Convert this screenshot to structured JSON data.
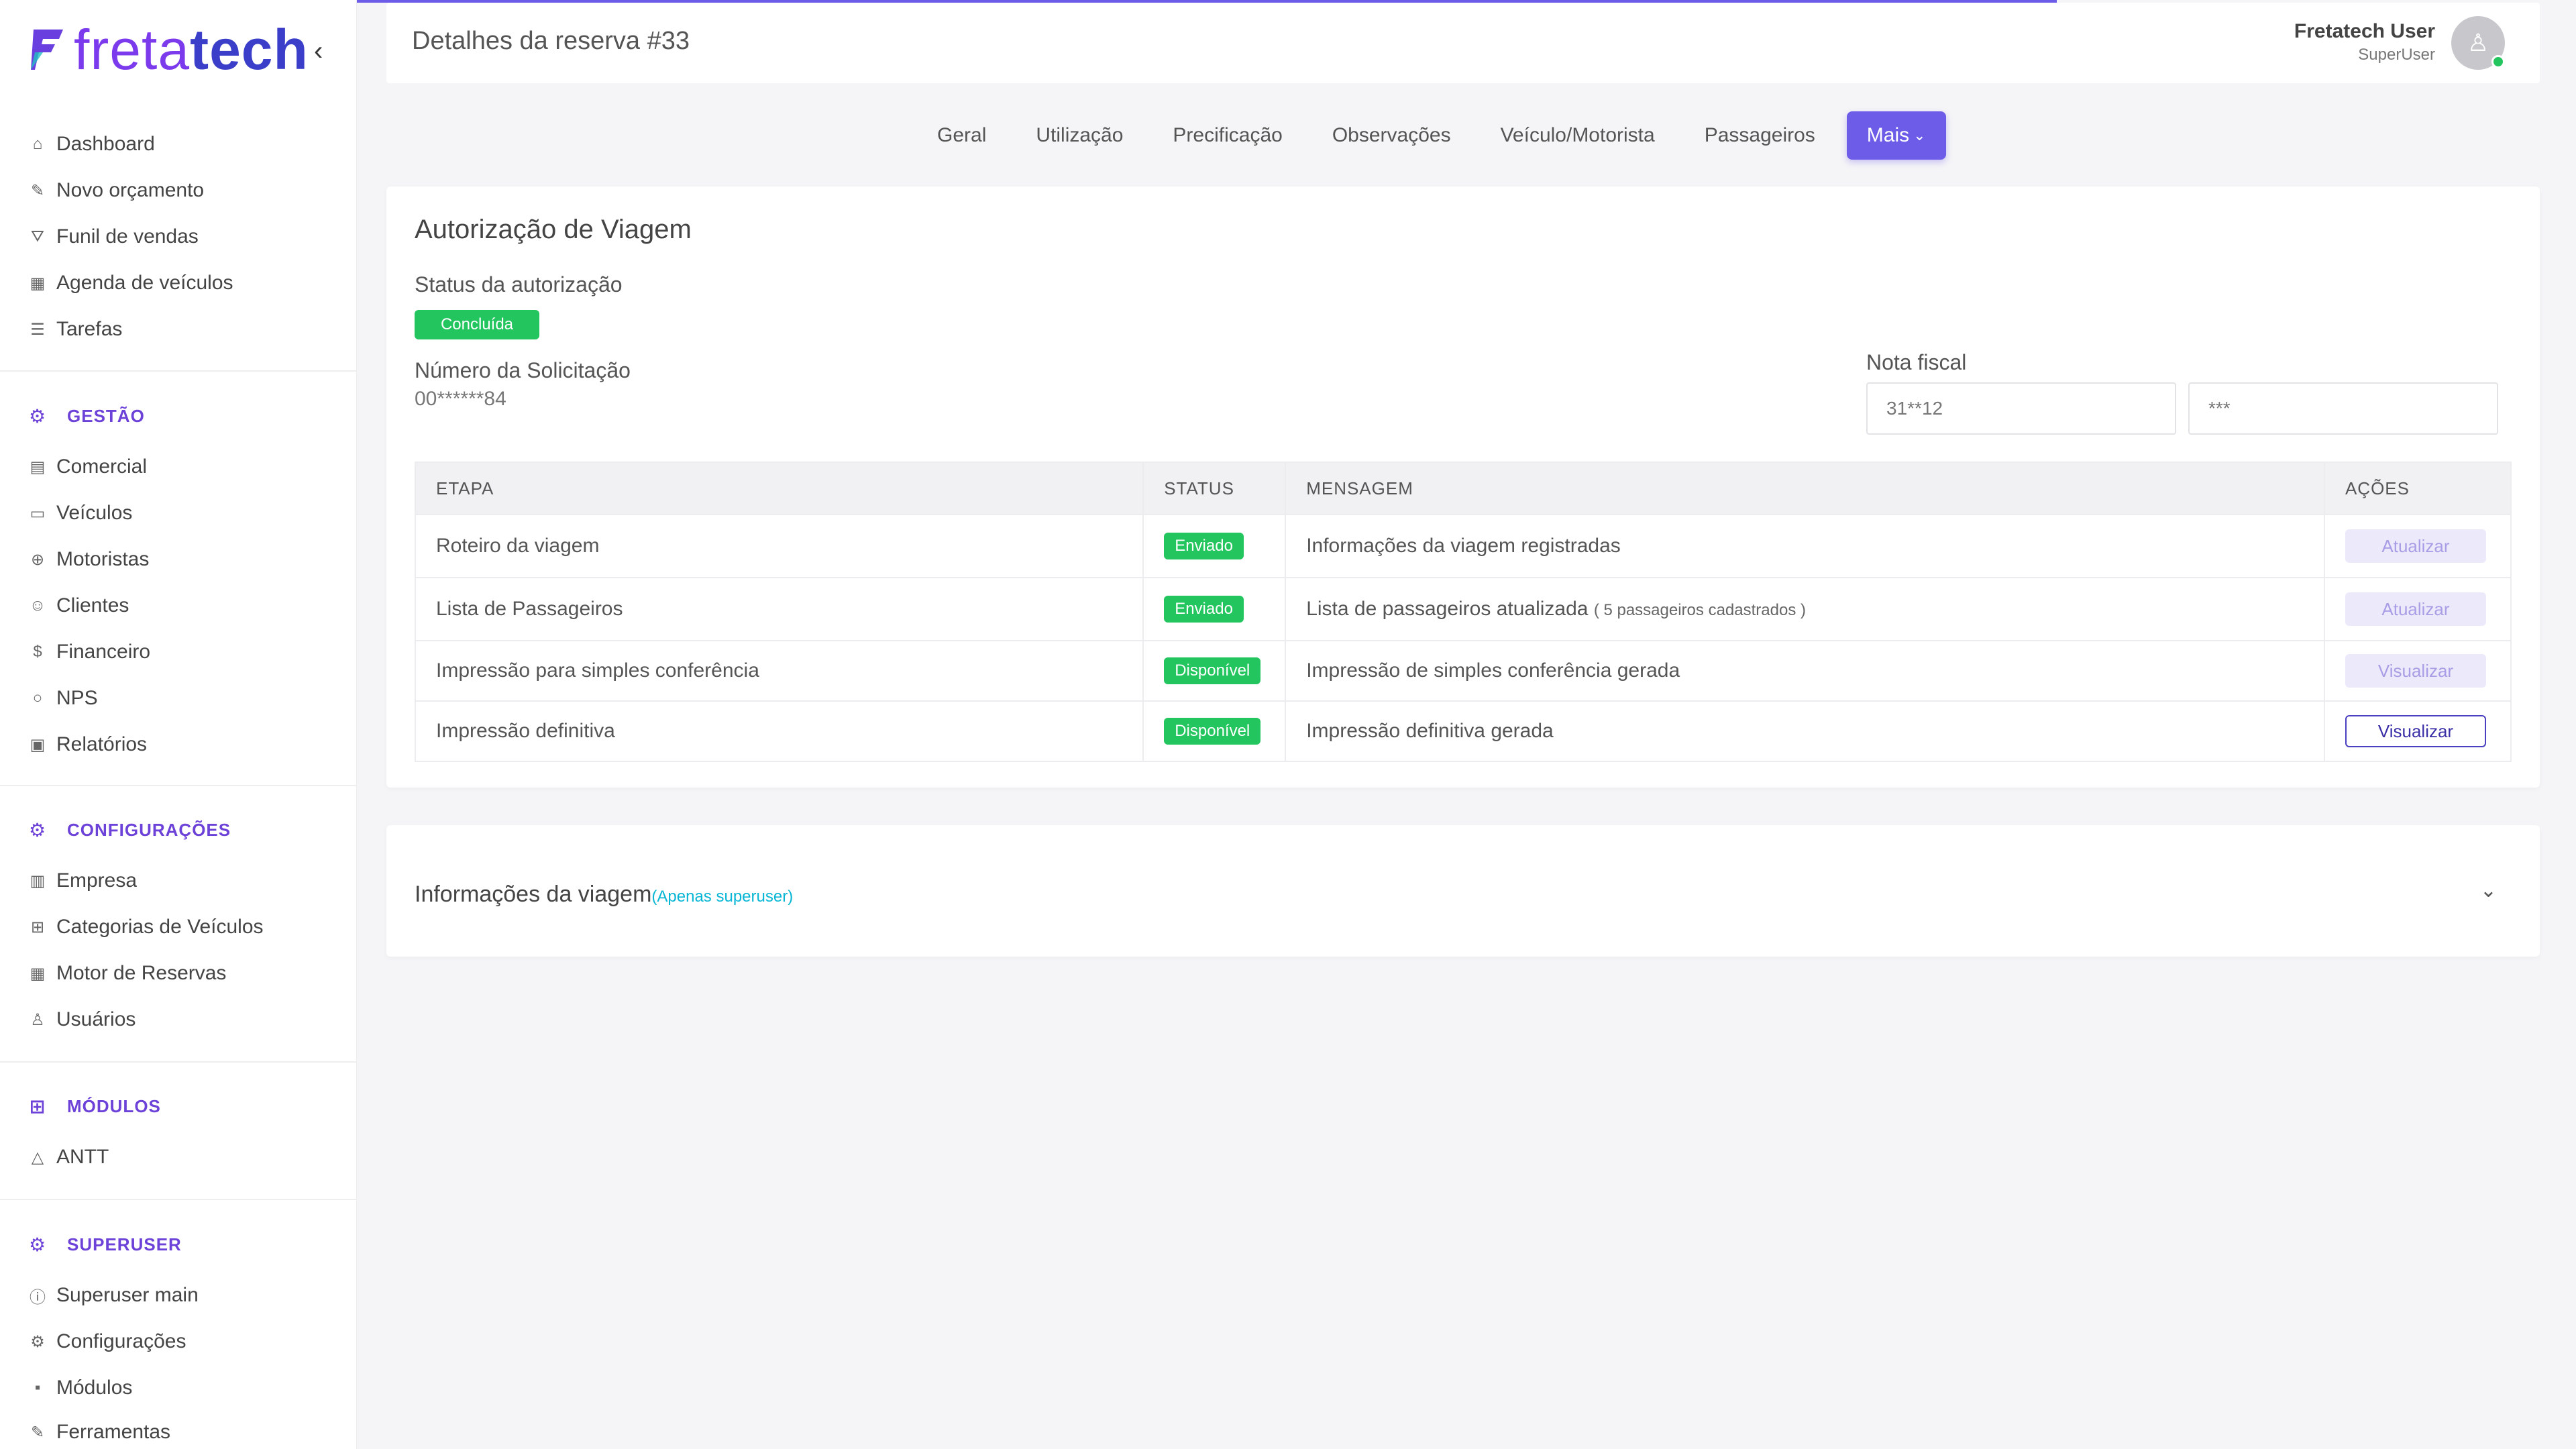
{
  "brand": {
    "logo_part1": "freta",
    "logo_part2": "tech",
    "collapse_icon": "chevron-left-icon"
  },
  "sidebar": {
    "main": [
      {
        "label": "Dashboard",
        "icon": "home-icon"
      },
      {
        "label": "Novo orçamento",
        "icon": "edit-icon"
      },
      {
        "label": "Funil de vendas",
        "icon": "funnel-icon"
      },
      {
        "label": "Agenda de veículos",
        "icon": "calendar-icon"
      },
      {
        "label": "Tarefas",
        "icon": "list-icon"
      }
    ],
    "gestao": {
      "title": "GESTÃO",
      "items": [
        {
          "label": "Comercial",
          "icon": "document-icon"
        },
        {
          "label": "Veículos",
          "icon": "bus-icon"
        },
        {
          "label": "Motoristas",
          "icon": "steering-wheel-icon"
        },
        {
          "label": "Clientes",
          "icon": "users-icon"
        },
        {
          "label": "Financeiro",
          "icon": "dollar-icon"
        },
        {
          "label": "NPS",
          "icon": "chat-icon"
        },
        {
          "label": "Relatórios",
          "icon": "report-icon"
        }
      ]
    },
    "configuracoes": {
      "title": "CONFIGURAÇÕES",
      "items": [
        {
          "label": "Empresa",
          "icon": "building-icon"
        },
        {
          "label": "Categorias de Veículos",
          "icon": "grid-icon"
        },
        {
          "label": "Motor de Reservas",
          "icon": "table-icon"
        },
        {
          "label": "Usuários",
          "icon": "user-icon"
        }
      ]
    },
    "modulos": {
      "title": "MÓDULOS",
      "items": [
        {
          "label": "ANTT",
          "icon": "triangle-icon"
        }
      ]
    },
    "superuser": {
      "title": "SUPERUSER",
      "items": [
        {
          "label": "Superuser main",
          "icon": "info-icon"
        },
        {
          "label": "Configurações",
          "icon": "gear-icon"
        },
        {
          "label": "Módulos",
          "icon": "modules-icon"
        },
        {
          "label": "Ferramentas",
          "icon": "wrench-icon"
        }
      ]
    }
  },
  "header": {
    "title": "Detalhes da reserva #33",
    "user_name": "Fretatech User",
    "user_role": "SuperUser"
  },
  "tabs": [
    {
      "label": "Geral"
    },
    {
      "label": "Utilização"
    },
    {
      "label": "Precificação"
    },
    {
      "label": "Observações"
    },
    {
      "label": "Veículo/Motorista"
    },
    {
      "label": "Passageiros"
    }
  ],
  "tab_active": {
    "label": "Mais"
  },
  "authorization": {
    "title": "Autorização de Viagem",
    "status_label": "Status da autorização",
    "status_value": "Concluída",
    "request_label": "Número da Solicitação",
    "request_value": "00******84",
    "nf_label": "Nota fiscal",
    "nf_value1": "31**12",
    "nf_value2": "***",
    "table": {
      "headers": [
        "ETAPA",
        "STATUS",
        "MENSAGEM",
        "AÇÕES"
      ],
      "rows": [
        {
          "etapa": "Roteiro da viagem",
          "status": "Enviado",
          "mensagem": "Informações da viagem registradas",
          "extra": "",
          "acao": "Atualizar"
        },
        {
          "etapa": "Lista de Passageiros",
          "status": "Enviado",
          "mensagem": "Lista de passageiros atualizada",
          "extra": "( 5 passageiros cadastrados )",
          "acao": "Atualizar"
        },
        {
          "etapa": "Impressão para simples conferência",
          "status": "Disponível",
          "mensagem": "Impressão de simples conferência gerada",
          "extra": "",
          "acao": "Visualizar"
        },
        {
          "etapa": "Impressão definitiva",
          "status": "Disponível",
          "mensagem": "Impressão definitiva gerada",
          "extra": "",
          "acao": "Visualizar"
        }
      ]
    }
  },
  "trip_info": {
    "title": "Informações da viagem",
    "note": "(Apenas superuser)"
  },
  "colors": {
    "accent": "#6c5ce7",
    "success": "#22c55e",
    "section": "#6d42d8",
    "cyan": "#06b6d4"
  }
}
